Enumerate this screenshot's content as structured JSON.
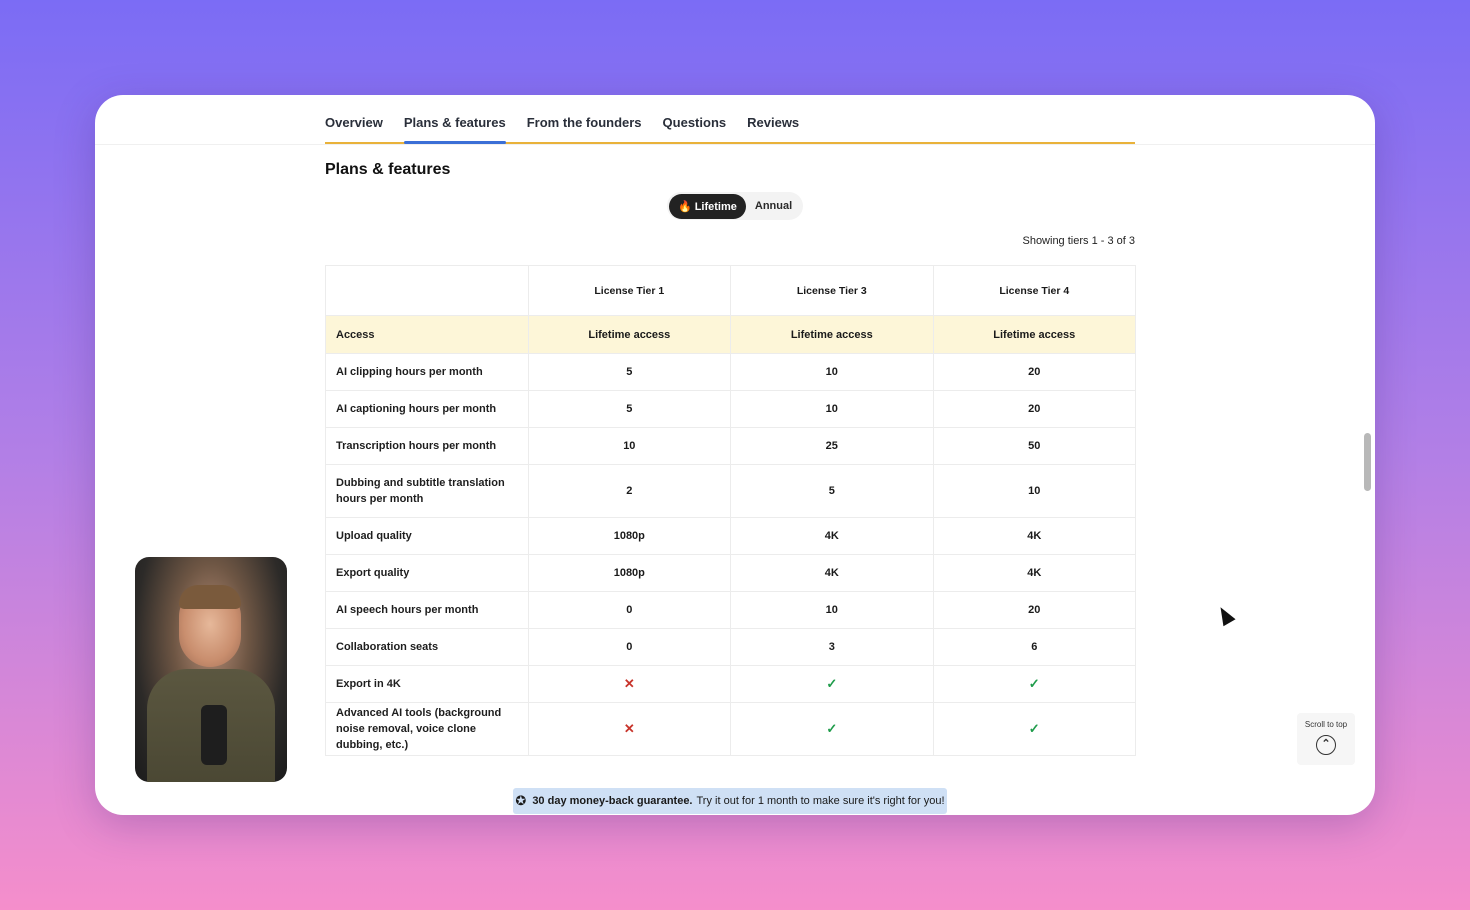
{
  "tabs": [
    "Overview",
    "Plans & features",
    "From the founders",
    "Questions",
    "Reviews"
  ],
  "section_title": "Plans & features",
  "toggle": {
    "lifetime": "Lifetime",
    "annual": "Annual",
    "selected": "Lifetime"
  },
  "showing": "Showing tiers 1 - 3 of 3",
  "table": {
    "columns": [
      "License Tier 1",
      "License Tier 3",
      "License Tier 4"
    ],
    "access": {
      "label": "Access",
      "values": [
        "Lifetime access",
        "Lifetime access",
        "Lifetime access"
      ]
    },
    "rows": [
      {
        "feature": "AI clipping hours per month",
        "values": [
          "5",
          "10",
          "20"
        ]
      },
      {
        "feature": "AI captioning hours per month",
        "values": [
          "5",
          "10",
          "20"
        ]
      },
      {
        "feature": "Transcription hours per month",
        "values": [
          "10",
          "25",
          "50"
        ]
      },
      {
        "feature": "Dubbing and subtitle translation hours per month",
        "values": [
          "2",
          "5",
          "10"
        ]
      },
      {
        "feature": "Upload quality",
        "values": [
          "1080p",
          "4K",
          "4K"
        ]
      },
      {
        "feature": "Export quality",
        "values": [
          "1080p",
          "4K",
          "4K"
        ]
      },
      {
        "feature": "AI speech hours per month",
        "values": [
          "0",
          "10",
          "20"
        ]
      },
      {
        "feature": "Collaboration seats",
        "values": [
          "0",
          "3",
          "6"
        ]
      },
      {
        "feature": "Export in 4K",
        "values": [
          "x",
          "check",
          "check"
        ]
      },
      {
        "feature": "Advanced AI tools (background noise removal, voice clone dubbing, etc.)",
        "values": [
          "x",
          "check",
          "check"
        ]
      }
    ]
  },
  "guarantee": {
    "bold": "30 day money-back guarantee.",
    "text": "Try it out for 1 month to make sure it's right for you!"
  },
  "scroll_to_top": "Scroll to top",
  "colors": {
    "accent_underline": "#3b6fd6",
    "tab_border": "#e9b23a",
    "access_row": "#fdf6d8",
    "check": "#1f9c4b",
    "cross": "#c8342b"
  }
}
